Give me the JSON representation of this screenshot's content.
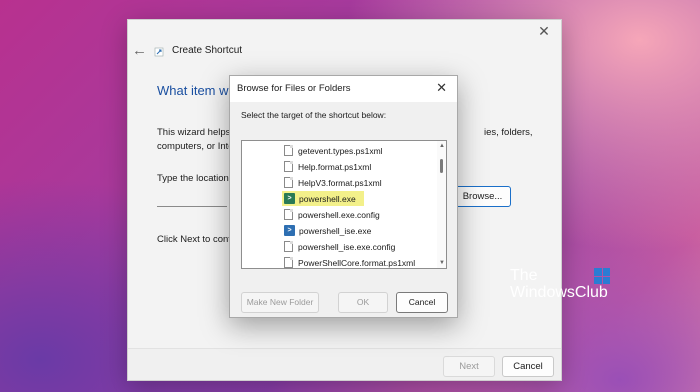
{
  "wizard": {
    "title": "Create Shortcut",
    "heading": "What item wo",
    "description_line1": "This wizard helps y",
    "description_right": "ies, folders,",
    "description_line2": "computers, or Inte",
    "type_location_label": "Type the location",
    "browse_label": "Browse...",
    "click_next_label": "Click Next to cont",
    "next_label": "Next",
    "cancel_label": "Cancel",
    "close_glyph": "✕",
    "back_glyph": "←"
  },
  "browse_dialog": {
    "title": "Browse for Files or Folders",
    "instruction": "Select the target of the shortcut below:",
    "close_glyph": "✕",
    "items": [
      {
        "label": "getevent.types.ps1xml",
        "icon": "file-icon"
      },
      {
        "label": "Help.format.ps1xml",
        "icon": "file-icon"
      },
      {
        "label": "HelpV3.format.ps1xml",
        "icon": "file-icon"
      },
      {
        "label": "powershell.exe",
        "icon": "powershell-icon",
        "highlighted": true
      },
      {
        "label": "powershell.exe.config",
        "icon": "file-icon"
      },
      {
        "label": "powershell_ise.exe",
        "icon": "powershell-ise-icon"
      },
      {
        "label": "powershell_ise.exe.config",
        "icon": "file-icon"
      },
      {
        "label": "PowerShellCore.format.ps1xml",
        "icon": "file-icon"
      }
    ],
    "make_new_folder_label": "Make New Folder",
    "ok_label": "OK",
    "cancel_label": "Cancel"
  },
  "watermark": {
    "line1": "The",
    "line2": "WindowsClub"
  },
  "colors": {
    "accent": "#1a4fa0",
    "highlight": "#f3f08a",
    "powershell_green": "#2a7a55",
    "powershell_blue": "#2e6fb2"
  }
}
